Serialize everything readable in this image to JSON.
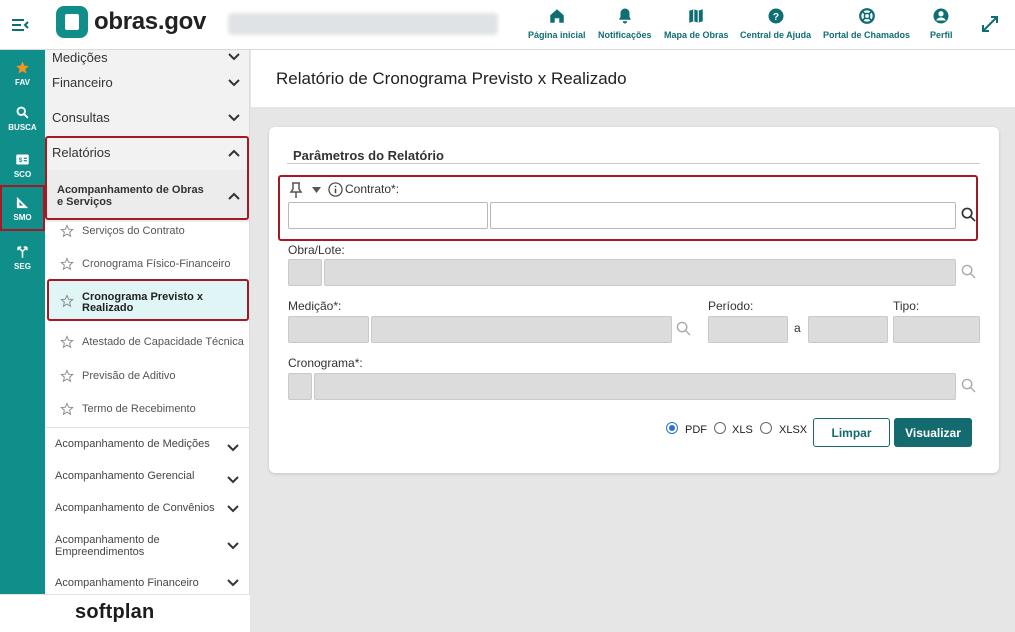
{
  "app": {
    "brand": "obras.gov",
    "footer_brand": "softplan"
  },
  "topnav": [
    {
      "label": "Página inicial",
      "icon": "home-icon"
    },
    {
      "label": "Notificações",
      "icon": "bell-icon"
    },
    {
      "label": "Mapa de Obras",
      "icon": "map-icon"
    },
    {
      "label": "Central de Ajuda",
      "icon": "help-icon"
    },
    {
      "label": "Portal de Chamados",
      "icon": "lifebuoy-icon"
    },
    {
      "label": "Perfil",
      "icon": "user-icon"
    }
  ],
  "rail": [
    {
      "label": "FAV",
      "icon": "star-icon"
    },
    {
      "label": "BUSCA",
      "icon": "search-icon"
    },
    {
      "label": "SCO",
      "icon": "sco-icon"
    },
    {
      "label": "SMO",
      "icon": "ruler-icon"
    },
    {
      "label": "SEG",
      "icon": "merge-icon"
    }
  ],
  "sidebar": {
    "partial_top": "Medições",
    "sections": [
      "Financeiro",
      "Consultas",
      "Relatórios"
    ],
    "subgroup": "Acompanhamento de Obras e Serviços",
    "items": [
      "Serviços do Contrato",
      "Cronograma Físico-Financeiro",
      "Cronograma Previsto x Realizado",
      "Atestado de Capacidade Técnica",
      "Previsão de Aditivo",
      "Termo de Recebimento"
    ],
    "accordions": [
      "Acompanhamento de Medições",
      "Acompanhamento Gerencial",
      "Acompanhamento de Convênios",
      "Acompanhamento de Empreendimentos",
      "Acompanhamento Financeiro"
    ]
  },
  "page": {
    "title": "Relatório de Cronograma Previsto x Realizado"
  },
  "form": {
    "title": "Parâmetros do Relatório",
    "contrato_label": "Contrato*:",
    "obra_label": "Obra/Lote:",
    "medicao_label": "Medição*:",
    "periodo_label": "Período:",
    "periodo_sep": "a",
    "tipo_label": "Tipo:",
    "cronograma_label": "Cronograma*:",
    "formats": [
      "PDF",
      "XLS",
      "XLSX"
    ],
    "selected_format": "PDF",
    "clear_label": "Limpar",
    "view_label": "Visualizar"
  },
  "colors": {
    "accent": "#0f8e8a",
    "primary_button": "#136b6f",
    "highlight": "#a31a24",
    "active_item_bg": "#e0f5f5"
  }
}
